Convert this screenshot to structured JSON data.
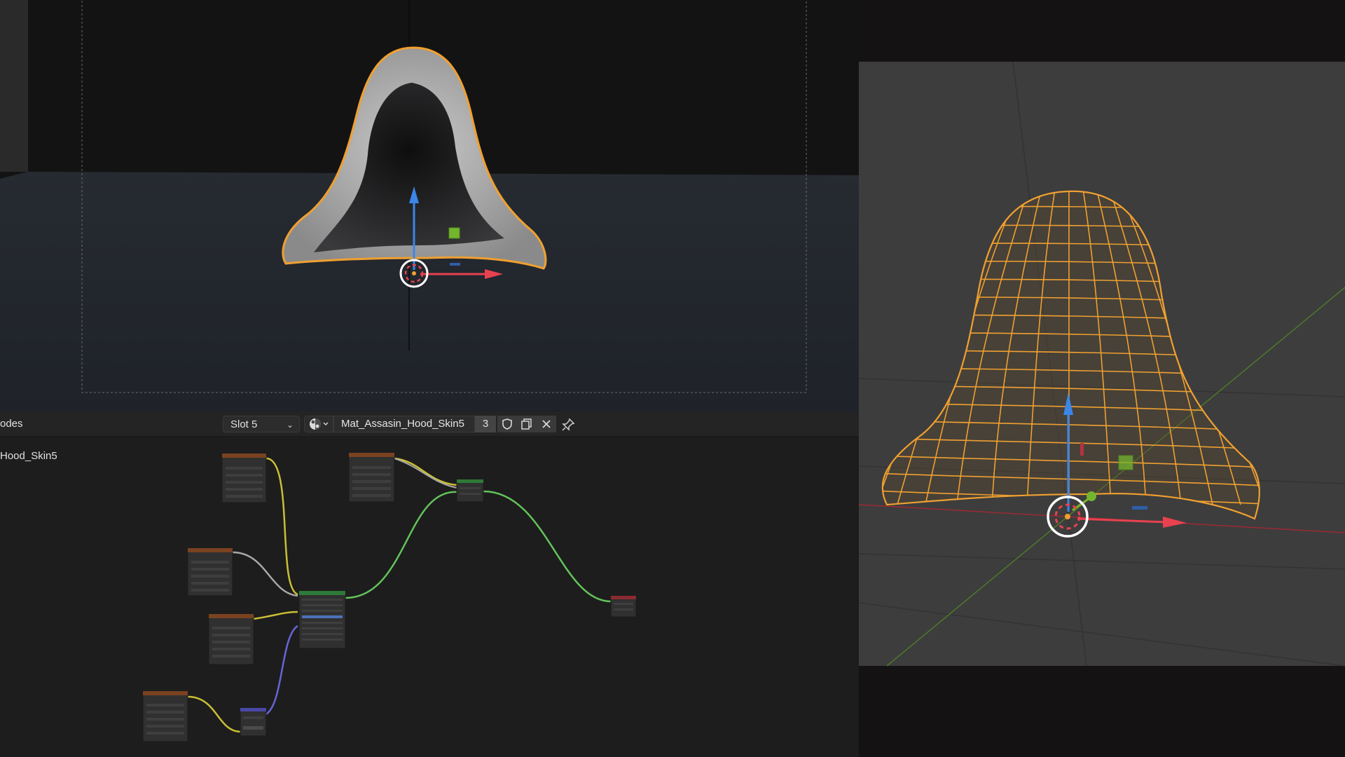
{
  "left_viewport": {
    "name": "3D Viewport – material preview"
  },
  "node_editor": {
    "editor_label": "odes",
    "slot": "Slot 5",
    "material_name": "Mat_Assasin_Hood_Skin5",
    "user_count": "3",
    "tree_label": "Hood_Skin5",
    "icons": [
      "shading-sphere-icon",
      "chevron-down-icon",
      "fake-user-shield-icon",
      "duplicate-icon",
      "close-icon",
      "pin-icon"
    ]
  },
  "right_viewport": {
    "name": "3D Viewport – wireframe"
  },
  "colors": {
    "selection_orange": "#f0a030",
    "axis_x": "#e8414f",
    "axis_z": "#3b86e8",
    "axis_y": "#74b52e",
    "link_yellow": "#c9bf34",
    "link_green": "#62c35b",
    "link_purple": "#6565d6",
    "link_gray": "#a8a8a8"
  }
}
